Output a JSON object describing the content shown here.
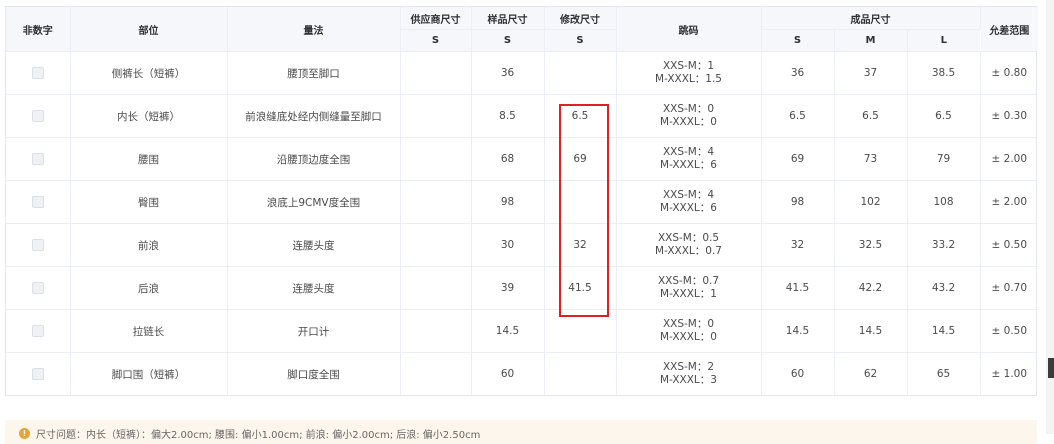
{
  "header": {
    "non_numeric": "非数字",
    "part": "部位",
    "measure_method": "量法",
    "supplier_size": "供应商尺寸",
    "sample_size": "样品尺寸",
    "modified_size": "修改尺寸",
    "jump_code": "跳码",
    "finished_size": "成品尺寸",
    "tolerance": "允差范围",
    "sub": {
      "supplier": "S",
      "sample": "S",
      "modified": "S",
      "finished": [
        "S",
        "M",
        "L"
      ]
    }
  },
  "rows": [
    {
      "part": "侧裤长（短裤）",
      "method": "腰顶至脚口",
      "supplier": "",
      "sample": "36",
      "modified": "",
      "jump1": "XXS-M：1",
      "jump2": "M-XXXL：1.5",
      "s": "36",
      "m": "37",
      "l": "38.5",
      "tol": "± 0.80"
    },
    {
      "part": "内长（短裤）",
      "method": "前浪缝底处经内侧缝量至脚口",
      "supplier": "",
      "sample": "8.5",
      "modified": "6.5",
      "jump1": "XXS-M：0",
      "jump2": "M-XXXL：0",
      "s": "6.5",
      "m": "6.5",
      "l": "6.5",
      "tol": "± 0.30"
    },
    {
      "part": "腰围",
      "method": "沿腰顶边度全围",
      "supplier": "",
      "sample": "68",
      "modified": "69",
      "jump1": "XXS-M：4",
      "jump2": "M-XXXL：6",
      "s": "69",
      "m": "73",
      "l": "79",
      "tol": "± 2.00"
    },
    {
      "part": "臀围",
      "method": "浪底上9CMV度全围",
      "supplier": "",
      "sample": "98",
      "modified": "",
      "jump1": "XXS-M：4",
      "jump2": "M-XXXL：6",
      "s": "98",
      "m": "102",
      "l": "108",
      "tol": "± 2.00"
    },
    {
      "part": "前浪",
      "method": "连腰头度",
      "supplier": "",
      "sample": "30",
      "modified": "32",
      "jump1": "XXS-M：0.5",
      "jump2": "M-XXXL：0.7",
      "s": "32",
      "m": "32.5",
      "l": "33.2",
      "tol": "± 0.50"
    },
    {
      "part": "后浪",
      "method": "连腰头度",
      "supplier": "",
      "sample": "39",
      "modified": "41.5",
      "jump1": "XXS-M：0.7",
      "jump2": "M-XXXL：1",
      "s": "41.5",
      "m": "42.2",
      "l": "43.2",
      "tol": "± 0.70"
    },
    {
      "part": "拉链长",
      "method": "开口计",
      "supplier": "",
      "sample": "14.5",
      "modified": "",
      "jump1": "XXS-M：0",
      "jump2": "M-XXXL：0",
      "s": "14.5",
      "m": "14.5",
      "l": "14.5",
      "tol": "± 0.50"
    },
    {
      "part": "脚口围（短裤）",
      "method": "脚口度全围",
      "supplier": "",
      "sample": "60",
      "modified": "",
      "jump1": "XXS-M：2",
      "jump2": "M-XXXL：3",
      "s": "60",
      "m": "62",
      "l": "65",
      "tol": "± 1.00"
    }
  ],
  "warning": {
    "icon": "warning-icon",
    "text": "尺寸问题：内长（短裤）：偏大2.00cm; 腰围: 偏小1.00cm; 前浪: 偏小2.00cm; 后浪: 偏小2.50cm"
  },
  "colors": {
    "highlight": "#e02020",
    "header_bg": "#f5f7fa",
    "warning_bg": "#fdf6ec",
    "warning_icon": "#e6a23c"
  }
}
